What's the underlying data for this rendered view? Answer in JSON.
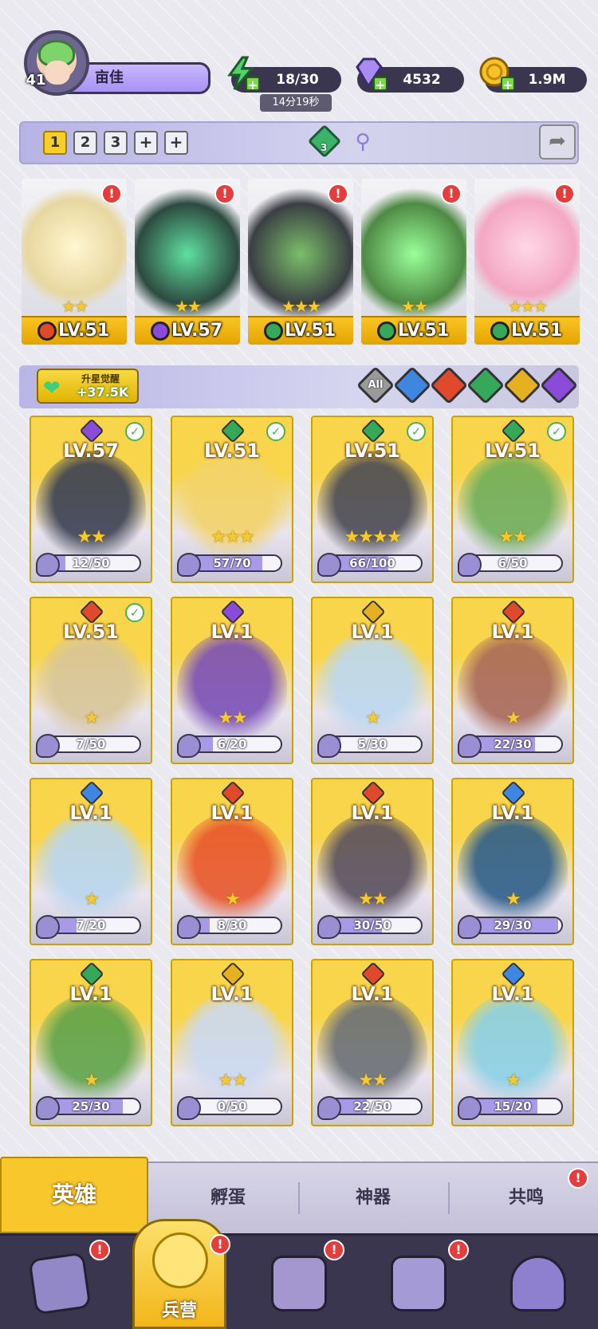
{
  "player": {
    "level": "41",
    "name": "亩佳"
  },
  "resources": {
    "energy": "18/30",
    "energy_timer": "14分19秒",
    "gems": "4532",
    "coins": "1.9M"
  },
  "team_tabs": [
    "1",
    "2",
    "3",
    "+",
    "+"
  ],
  "team_gem_count": "3",
  "team": [
    {
      "level": "LV.51",
      "stars": "★★",
      "element": "fire",
      "color": "#e0492c"
    },
    {
      "level": "LV.57",
      "stars": "★★",
      "element": "dark",
      "color": "#8a4bd8"
    },
    {
      "level": "LV.51",
      "stars": "★★★",
      "element": "nature",
      "color": "#36a85a"
    },
    {
      "level": "LV.51",
      "stars": "★★",
      "element": "nature",
      "color": "#36a85a"
    },
    {
      "level": "LV.51",
      "stars": "★★★",
      "element": "nature",
      "color": "#36a85a"
    }
  ],
  "awaken": {
    "label": "升星觉醒",
    "value": "+37.5K"
  },
  "filters": [
    {
      "name": "all",
      "label": "All",
      "color": "#9a9a9a"
    },
    {
      "name": "water",
      "label": "",
      "color": "#3f86e0"
    },
    {
      "name": "fire",
      "label": "",
      "color": "#e0492c"
    },
    {
      "name": "nature",
      "label": "",
      "color": "#36a85a"
    },
    {
      "name": "light",
      "label": "",
      "color": "#e7b020"
    },
    {
      "name": "dark",
      "label": "",
      "color": "#8a4bd8"
    }
  ],
  "heroes": [
    {
      "level": "LV.57",
      "progress": "12/50",
      "ratio": 0.24,
      "stars": "★★",
      "element_color": "#8a4bd8",
      "art": "#3a3f52",
      "checked": true
    },
    {
      "level": "LV.51",
      "progress": "57/70",
      "ratio": 0.81,
      "stars": "★★★",
      "element_color": "#36a85a",
      "art": "#f2d36b",
      "checked": true
    },
    {
      "level": "LV.51",
      "progress": "66/100",
      "ratio": 0.66,
      "stars": "★★★★",
      "element_color": "#36a85a",
      "art": "#4a4a55",
      "checked": true
    },
    {
      "level": "LV.51",
      "progress": "6/50",
      "ratio": 0.12,
      "stars": "★★",
      "element_color": "#36a85a",
      "art": "#6fae5a",
      "checked": true
    },
    {
      "level": "LV.51",
      "progress": "7/50",
      "ratio": 0.14,
      "stars": "★",
      "element_color": "#e0492c",
      "art": "#d8c59a",
      "checked": true
    },
    {
      "level": "LV.1",
      "progress": "6/20",
      "ratio": 0.3,
      "stars": "★★",
      "element_color": "#8a4bd8",
      "art": "#7b4fb8",
      "checked": false
    },
    {
      "level": "LV.1",
      "progress": "5/30",
      "ratio": 0.17,
      "stars": "★",
      "element_color": "#e7b020",
      "art": "#bcd8f0",
      "checked": false
    },
    {
      "level": "LV.1",
      "progress": "22/30",
      "ratio": 0.73,
      "stars": "★",
      "element_color": "#e0492c",
      "art": "#a8695a",
      "checked": false
    },
    {
      "level": "LV.1",
      "progress": "7/20",
      "ratio": 0.35,
      "stars": "★",
      "element_color": "#3f86e0",
      "art": "#b9d6ef",
      "checked": false
    },
    {
      "level": "LV.1",
      "progress": "8/30",
      "ratio": 0.27,
      "stars": "★",
      "element_color": "#e0492c",
      "art": "#e8562c",
      "checked": false
    },
    {
      "level": "LV.1",
      "progress": "30/50",
      "ratio": 0.6,
      "stars": "★★",
      "element_color": "#e0492c",
      "art": "#5a5060",
      "checked": false
    },
    {
      "level": "LV.1",
      "progress": "29/30",
      "ratio": 0.97,
      "stars": "★",
      "element_color": "#3f86e0",
      "art": "#2f5e8a",
      "checked": false
    },
    {
      "level": "LV.1",
      "progress": "25/30",
      "ratio": 0.83,
      "stars": "★",
      "element_color": "#36a85a",
      "art": "#5fa34a",
      "checked": false
    },
    {
      "level": "LV.1",
      "progress": "0/50",
      "ratio": 0.0,
      "stars": "★★",
      "element_color": "#e7b020",
      "art": "#cbd9f2",
      "checked": false
    },
    {
      "level": "LV.1",
      "progress": "22/50",
      "ratio": 0.44,
      "stars": "★★",
      "element_color": "#e0492c",
      "art": "#6a6f78",
      "checked": false
    },
    {
      "level": "LV.1",
      "progress": "15/20",
      "ratio": 0.75,
      "stars": "★",
      "element_color": "#3f86e0",
      "art": "#8ad0e6",
      "checked": false
    }
  ],
  "tabs": {
    "hero": "英雄",
    "hatch": "孵蛋",
    "artifact": "神器",
    "resonance": "共鸣"
  },
  "nav": {
    "barracks": "兵营"
  },
  "alert_mark": "!"
}
